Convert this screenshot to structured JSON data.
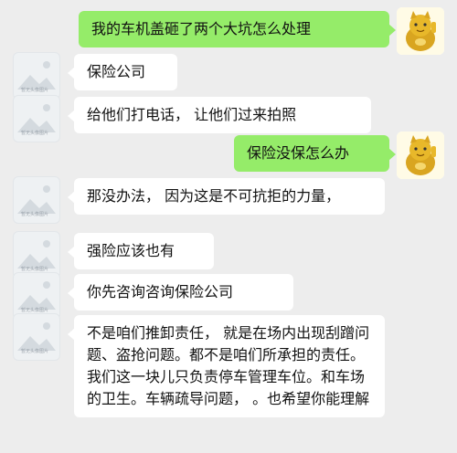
{
  "placeholder_avatar_text": "暂无头像图片",
  "messages": [
    {
      "side": "right",
      "text": "我的车机盖砸了两个大坑怎么处理"
    },
    {
      "side": "left",
      "text": "保险公司"
    },
    {
      "side": "left",
      "text": "给他们打电话， 让他们过来拍照"
    },
    {
      "side": "right",
      "text": "保险没保怎么办"
    },
    {
      "side": "left",
      "text": "那没办法， 因为这是不可抗拒的力量，"
    },
    {
      "side": "left",
      "text": "强险应该也有"
    },
    {
      "side": "left",
      "text": "你先咨询咨询保险公司"
    },
    {
      "side": "left",
      "text": "不是咱们推卸责任， 就是在场内出现刮蹭问题、盗抢问题。都不是咱们所承担的责任。我们这一块儿只负责停车管理车位。和车场的卫生。车辆疏导问题， 。也希望你能理解"
    }
  ]
}
